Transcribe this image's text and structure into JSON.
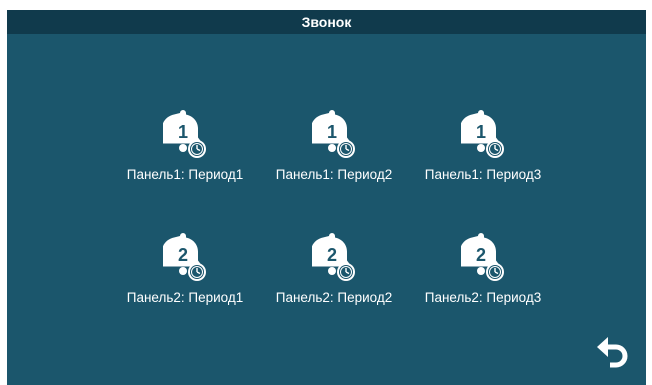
{
  "window": {
    "title": "Звонок"
  },
  "items": [
    {
      "label": "Панель1: Период1",
      "panel": "1",
      "icon": "bell-clock-icon"
    },
    {
      "label": "Панель1: Период2",
      "panel": "1",
      "icon": "bell-clock-icon"
    },
    {
      "label": "Панель1: Период3",
      "panel": "1",
      "icon": "bell-clock-icon"
    },
    {
      "label": "Панель2: Период1",
      "panel": "2",
      "icon": "bell-clock-icon"
    },
    {
      "label": "Панель2: Период2",
      "panel": "2",
      "icon": "bell-clock-icon"
    },
    {
      "label": "Панель2: Период3",
      "panel": "2",
      "icon": "bell-clock-icon"
    }
  ],
  "nav": {
    "back_icon": "back-arrow-icon"
  },
  "colors": {
    "background": "#1b566c",
    "titlebar": "#103a4c",
    "text": "#ffffff"
  }
}
